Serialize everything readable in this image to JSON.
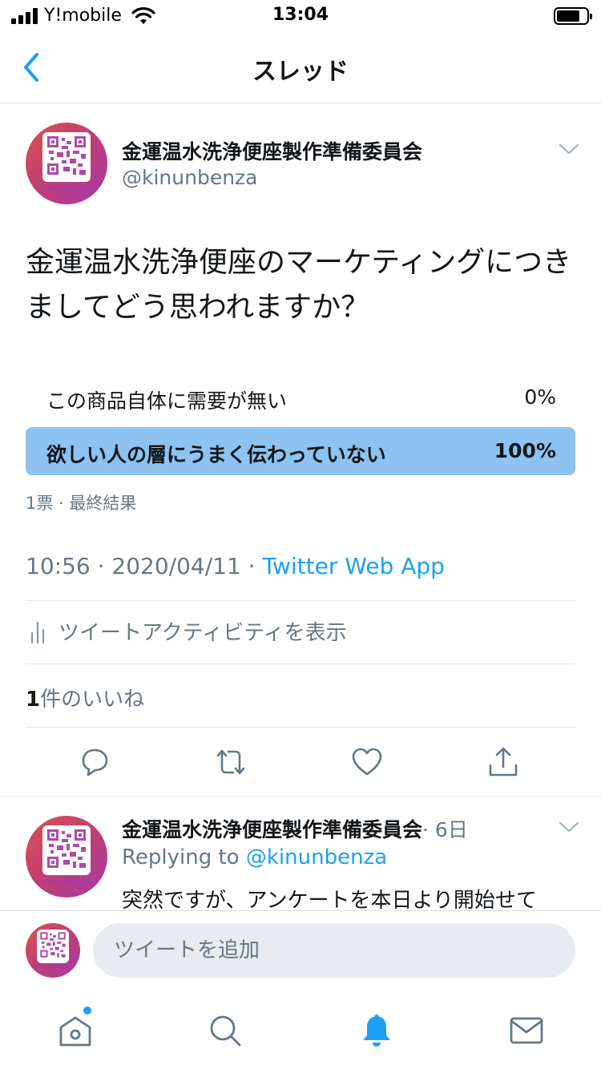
{
  "status_bar": {
    "carrier": "Y!mobile",
    "time": "13:04"
  },
  "nav": {
    "title": "スレッド"
  },
  "tweet": {
    "author_name": "金運温水洗浄便座製作準備委員会",
    "handle": "@kinunbenza",
    "avatar_brand": "KINUNBENZA",
    "text": "金運温水洗浄便座のマーケティングにつきましてどう思われますか？",
    "poll": {
      "options": [
        {
          "label": "この商品自体に需要が無い",
          "percent": "0%",
          "fraction": 0,
          "winner": false
        },
        {
          "label": "欲しい人の層にうまく伝わっていない",
          "percent": "100%",
          "fraction": 1,
          "winner": true
        }
      ],
      "meta": "1票 · 最終結果"
    },
    "time": "10:56",
    "separator": " · ",
    "date": "2020/04/11",
    "source": "Twitter Web App",
    "activity_label": "ツイートアクティビティを表示",
    "likes_count": "1",
    "likes_label": "件のいいね"
  },
  "reply": {
    "author_name": "金運温水洗浄便座製作準備委員会",
    "age": "· 6日",
    "replying_prefix": "Replying to ",
    "replying_handle": "@kinunbenza",
    "text": "突然ですが、アンケートを本日より開始せて"
  },
  "compose": {
    "placeholder": "ツイートを追加"
  },
  "colors": {
    "accent": "#1da1f2",
    "poll_fill": "#8cc3f0",
    "secondary_text": "#657786"
  },
  "icons": {
    "back": "chevron-left-icon",
    "menu": "chevron-down-icon",
    "reply": "comment-icon",
    "retweet": "retweet-icon",
    "like": "heart-icon",
    "share": "share-icon",
    "activity": "bar-chart-icon",
    "tabs": [
      "home-icon",
      "search-icon",
      "bell-icon",
      "mail-icon"
    ]
  }
}
